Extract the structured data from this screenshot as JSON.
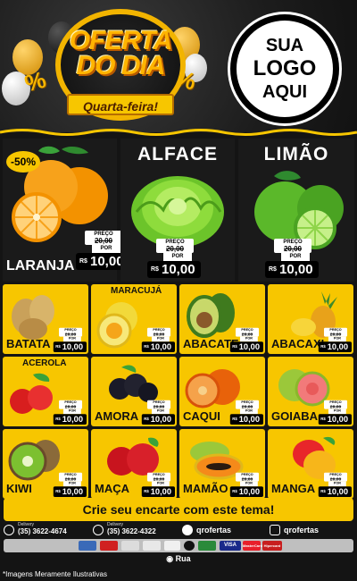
{
  "header": {
    "title_line1": "OFERTA",
    "title_line2": "DO DIA",
    "subtitle": "Quarta-feira!",
    "logo_line1": "SUA",
    "logo_line2": "LOGO",
    "logo_line3": "AQUI"
  },
  "price_labels": {
    "preco": "PREÇO",
    "por": "POR",
    "rs": "R$",
    "unid": "UNID"
  },
  "featured": [
    {
      "name": "LARANJA",
      "was": "20,00",
      "now": "10,00",
      "discount": "-50%",
      "title": ""
    },
    {
      "name": "",
      "was": "20,00",
      "now": "10,00",
      "title": "ALFACE"
    },
    {
      "name": "",
      "was": "20,00",
      "now": "10,00",
      "title": "LIMÃO"
    }
  ],
  "grid": [
    {
      "name": "BATATA",
      "was": "20,00",
      "now": "10,00",
      "top": ""
    },
    {
      "name": "PASSION",
      "was": "20,00",
      "now": "10,00",
      "top": "MARACUJÁ"
    },
    {
      "name": "ABACATE",
      "was": "20,00",
      "now": "10,00",
      "top": ""
    },
    {
      "name": "ABACAXI",
      "was": "20,00",
      "now": "10,00",
      "top": ""
    },
    {
      "name": "",
      "was": "20,00",
      "now": "10,00",
      "top": "ACEROLA"
    },
    {
      "name": "AMORA",
      "was": "20,00",
      "now": "10,00",
      "top": ""
    },
    {
      "name": "CAQUI",
      "was": "20,00",
      "now": "10,00",
      "top": ""
    },
    {
      "name": "GOIABA",
      "was": "20,00",
      "now": "10,00",
      "top": ""
    },
    {
      "name": "KIWI",
      "was": "20,00",
      "now": "10,00",
      "top": ""
    },
    {
      "name": "MAÇA",
      "was": "20,00",
      "now": "10,00",
      "top": ""
    },
    {
      "name": "MAMÃO",
      "was": "20,00",
      "now": "10,00",
      "top": ""
    },
    {
      "name": "MANGA",
      "was": "20,00",
      "now": "10,00",
      "top": ""
    }
  ],
  "cta": "Crie seu encarte com este tema!",
  "contacts": {
    "whatsapp_label": "Delivery",
    "whatsapp_number": "(35) 3622-4674",
    "phone_label": "Delivery",
    "phone_number": "(35) 3622-4322",
    "facebook": "qrofertas",
    "instagram": "qrofertas"
  },
  "payments": [
    "VISA",
    "MasterCard",
    "Hipercard"
  ],
  "address": "Rua",
  "disclaimer": "*Imagens Meramente Ilustrativas",
  "colors": {
    "accent": "#f7c600",
    "background": "#141414"
  },
  "icons": [
    "whatsapp-icon",
    "phone-icon",
    "facebook-icon",
    "instagram-icon",
    "location-pin-icon"
  ]
}
